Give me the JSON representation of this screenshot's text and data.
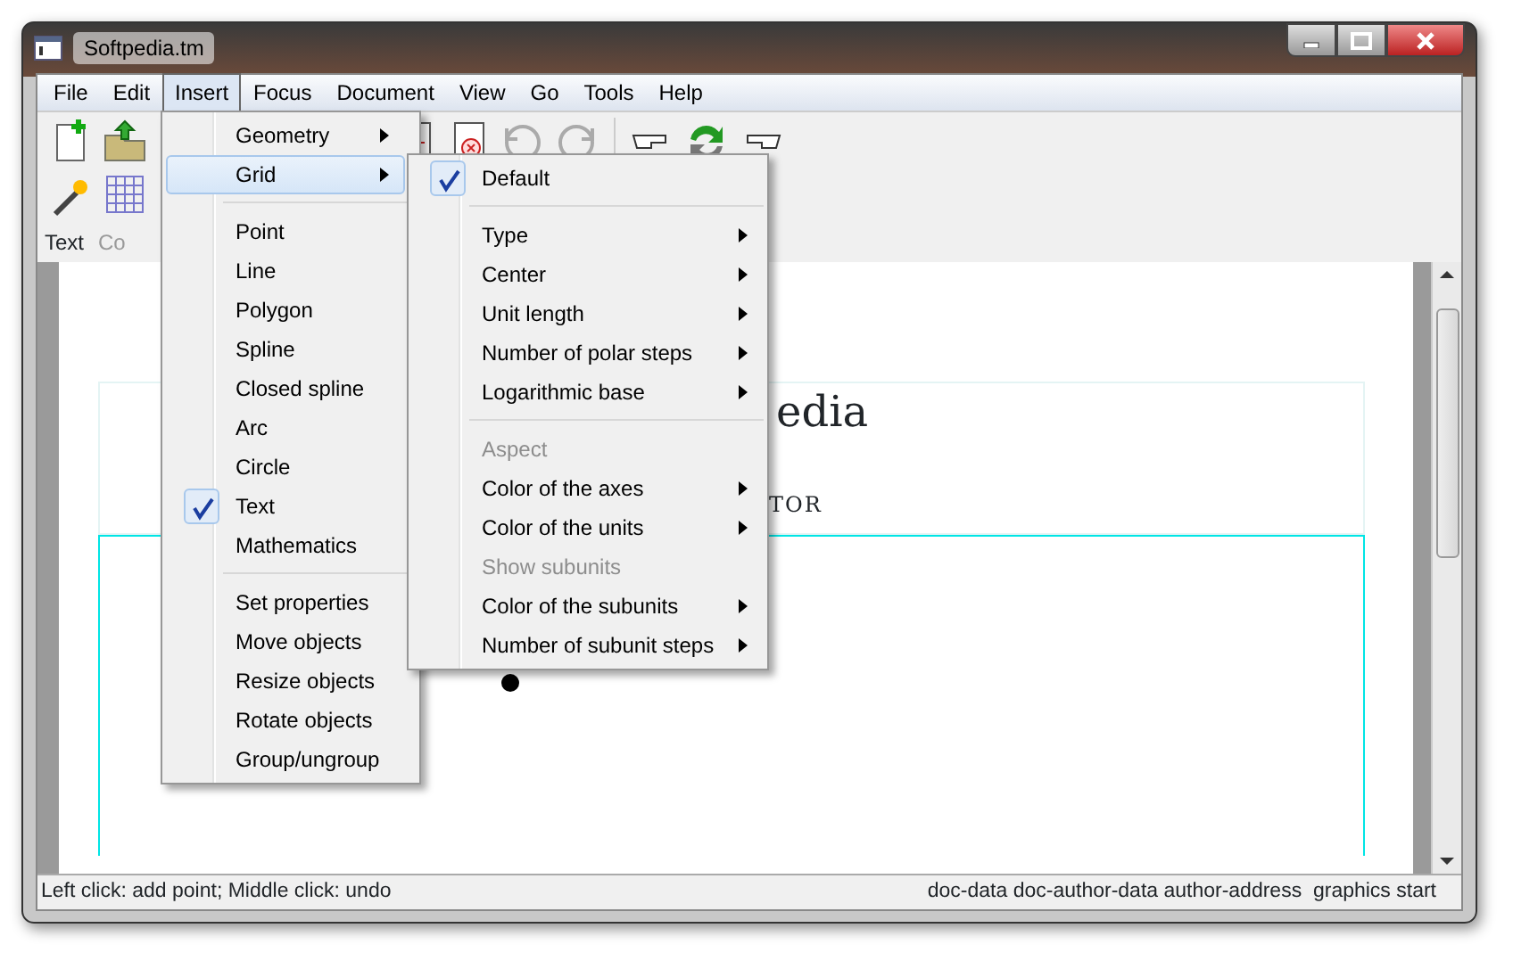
{
  "window": {
    "title": "Softpedia.tm"
  },
  "menubar": [
    {
      "label": "File",
      "selected": false
    },
    {
      "label": "Edit",
      "selected": false
    },
    {
      "label": "Insert",
      "selected": true
    },
    {
      "label": "Focus",
      "selected": false
    },
    {
      "label": "Document",
      "selected": false
    },
    {
      "label": "View",
      "selected": false
    },
    {
      "label": "Go",
      "selected": false
    },
    {
      "label": "Tools",
      "selected": false
    },
    {
      "label": "Help",
      "selected": false
    }
  ],
  "mode_bar": [
    {
      "label": "Text",
      "disabled": false
    },
    {
      "label": "Co",
      "disabled": true
    }
  ],
  "insert_menu": [
    {
      "kind": "submenu",
      "label": "Geometry",
      "checked": false,
      "highlighted": false
    },
    {
      "kind": "submenu",
      "label": "Grid",
      "checked": false,
      "highlighted": true
    },
    {
      "kind": "separator"
    },
    {
      "kind": "item",
      "label": "Point",
      "checked": false,
      "highlighted": false
    },
    {
      "kind": "item",
      "label": "Line",
      "checked": false,
      "highlighted": false
    },
    {
      "kind": "item",
      "label": "Polygon",
      "checked": false,
      "highlighted": false
    },
    {
      "kind": "item",
      "label": "Spline",
      "checked": false,
      "highlighted": false
    },
    {
      "kind": "item",
      "label": "Closed spline",
      "checked": false,
      "highlighted": false
    },
    {
      "kind": "item",
      "label": "Arc",
      "checked": false,
      "highlighted": false
    },
    {
      "kind": "item",
      "label": "Circle",
      "checked": false,
      "highlighted": false
    },
    {
      "kind": "item",
      "label": "Text",
      "checked": true,
      "highlighted": false
    },
    {
      "kind": "item",
      "label": "Mathematics",
      "checked": false,
      "highlighted": false
    },
    {
      "kind": "separator"
    },
    {
      "kind": "item",
      "label": "Set properties",
      "checked": false,
      "highlighted": false
    },
    {
      "kind": "item",
      "label": "Move objects",
      "checked": false,
      "highlighted": false
    },
    {
      "kind": "item",
      "label": "Resize objects",
      "checked": false,
      "highlighted": false
    },
    {
      "kind": "item",
      "label": "Rotate objects",
      "checked": false,
      "highlighted": false
    },
    {
      "kind": "item",
      "label": "Group/ungroup",
      "checked": false,
      "highlighted": false
    }
  ],
  "grid_submenu": [
    {
      "kind": "item",
      "label": "Default",
      "checked": true,
      "disabled": false
    },
    {
      "kind": "separator"
    },
    {
      "kind": "submenu",
      "label": "Type",
      "checked": false,
      "disabled": false
    },
    {
      "kind": "submenu",
      "label": "Center",
      "checked": false,
      "disabled": false
    },
    {
      "kind": "submenu",
      "label": "Unit length",
      "checked": false,
      "disabled": false
    },
    {
      "kind": "submenu",
      "label": "Number of polar steps",
      "checked": false,
      "disabled": false
    },
    {
      "kind": "submenu",
      "label": "Logarithmic base",
      "checked": false,
      "disabled": false
    },
    {
      "kind": "separator"
    },
    {
      "kind": "item",
      "label": "Aspect",
      "checked": false,
      "disabled": true
    },
    {
      "kind": "submenu",
      "label": "Color of the axes",
      "checked": false,
      "disabled": false
    },
    {
      "kind": "submenu",
      "label": "Color of the units",
      "checked": false,
      "disabled": false
    },
    {
      "kind": "item",
      "label": "Show subunits",
      "checked": false,
      "disabled": true
    },
    {
      "kind": "submenu",
      "label": "Color of the subunits",
      "checked": false,
      "disabled": false
    },
    {
      "kind": "submenu",
      "label": "Number of subunit steps",
      "checked": false,
      "disabled": false
    }
  ],
  "document": {
    "title_fragment": "edia",
    "subtitle_fragment": "TOR"
  },
  "status_bar": {
    "left": "Left click: add point; Middle click: undo",
    "right": "doc-data doc-author-data author-address  graphics start"
  }
}
